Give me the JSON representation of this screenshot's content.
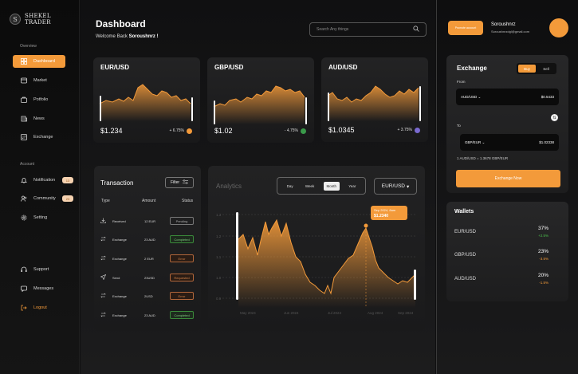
{
  "brand": {
    "logo_letter": "S",
    "name": "SHEKEL TRADER"
  },
  "sidebar": {
    "overview_label": "Overview",
    "account_label": "Account",
    "items": [
      {
        "label": "Dashboard",
        "icon": "grid-icon"
      },
      {
        "label": "Market",
        "icon": "market-icon"
      },
      {
        "label": "Potfolio",
        "icon": "briefcase-icon"
      },
      {
        "label": "News",
        "icon": "news-icon"
      },
      {
        "label": "Exchange",
        "icon": "exchange-icon"
      }
    ],
    "account_items": [
      {
        "label": "Notification",
        "badge": "13"
      },
      {
        "label": "Community",
        "badge": "23"
      },
      {
        "label": "Setting"
      }
    ],
    "bottom_items": [
      {
        "label": "Support"
      },
      {
        "label": "Messages"
      },
      {
        "label": "Logout"
      }
    ]
  },
  "header": {
    "title": "Dashboard",
    "welcome_prefix": "Welcome Back ",
    "welcome_name": "Soroushnrz !",
    "search_placeholder": "Search Any things"
  },
  "cards": [
    {
      "pair": "EUR/USD",
      "price": "$1.234",
      "change": "+ 6.75%",
      "dot_color": "#f39a3a"
    },
    {
      "pair": "GBP/USD",
      "price": "$1.02",
      "change": "- 4.75%",
      "dot_color": "#3a9a4a"
    },
    {
      "pair": "AUD/USD",
      "price": "$1.0345",
      "change": "+ 3.75%",
      "dot_color": "#7a6ad0"
    }
  ],
  "transactions": {
    "title": "Transaction",
    "filter_label": "Filter",
    "headers": {
      "type": "Type",
      "amount": "Amount",
      "status": "Status"
    },
    "rows": [
      {
        "type": "Received",
        "amount": "12 EUR",
        "status": "Pending",
        "kind": "pending"
      },
      {
        "type": "Exchange",
        "amount": "23 AUD",
        "status": "Completed",
        "kind": "completed"
      },
      {
        "type": "Exchange",
        "amount": "2 EUR",
        "status": "Error",
        "kind": "error"
      },
      {
        "type": "Send",
        "amount": "23USD",
        "status": "Requested",
        "kind": "error"
      },
      {
        "type": "Exchange",
        "amount": "2USD",
        "status": "Error",
        "kind": "error"
      },
      {
        "type": "Exchange",
        "amount": "23 AUD",
        "status": "Completed",
        "kind": "completed"
      }
    ]
  },
  "analytics": {
    "title": "Analytics",
    "tabs": [
      "Day",
      "Week",
      "Month",
      "Year"
    ],
    "active_tab": "Month",
    "currency": "EUR/USD",
    "tooltip_date": "Sep 2024, 8am",
    "tooltip_value": "$1.2340",
    "y_ticks": [
      "1.3",
      "1.2",
      "1.1",
      "1.0",
      "0.9"
    ],
    "x_ticks": [
      "May 2024",
      "Jun 2024",
      "Jul 2024",
      "Aug 2024",
      "Sep 2024"
    ]
  },
  "user": {
    "promo_label": "Promote account",
    "name": "Soroushnrz",
    "email": "Soroushnrzdgl@gmail.com"
  },
  "exchange": {
    "title": "Exchange",
    "buy_label": "Buy",
    "sell_label": "Sell",
    "from_label": "From",
    "to_label": "To",
    "from_pair": "AUD/USD",
    "from_value": "$0.5433",
    "to_pair": "GBP/EUR",
    "to_value": "$1.02338",
    "rate": "1 AUD/USD = 1.3678 GBP/EUR",
    "button_label": "Exchange Now"
  },
  "wallets": {
    "title": "Wallets",
    "rows": [
      {
        "name": "EUR/USD",
        "percent": "37%",
        "change": "+2.5%",
        "color": "#4cc04c"
      },
      {
        "name": "GBP/USD",
        "percent": "23%",
        "change": "-3.5%",
        "color": "#f39a3a"
      },
      {
        "name": "AUD/USD",
        "percent": "20%",
        "change": "-1.5%",
        "color": "#f39a3a"
      }
    ]
  },
  "colors": {
    "accent": "#f39a3a",
    "bg": "#0f0f10",
    "card": "#222223"
  }
}
